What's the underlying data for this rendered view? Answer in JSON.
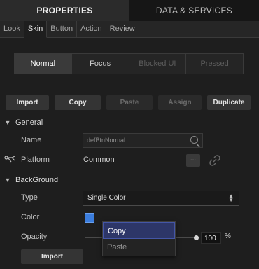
{
  "main_tabs": [
    {
      "label": "PROPERTIES",
      "active": true
    },
    {
      "label": "DATA & SERVICES",
      "active": false
    }
  ],
  "sub_tabs": [
    {
      "label": "Look"
    },
    {
      "label": "Skin"
    },
    {
      "label": "Button"
    },
    {
      "label": "Action"
    },
    {
      "label": "Review"
    }
  ],
  "states": [
    {
      "label": "Normal"
    },
    {
      "label": "Focus"
    },
    {
      "label": "Blocked UI"
    },
    {
      "label": "Pressed"
    }
  ],
  "actions": {
    "import": "Import",
    "copy": "Copy",
    "paste": "Paste",
    "assign": "Assign",
    "duplicate": "Duplicate"
  },
  "general": {
    "title": "General",
    "name_label": "Name",
    "name_value": "defBtnNormal",
    "platform_label": "Platform",
    "platform_value": "Common",
    "dots": "..."
  },
  "background": {
    "title": "BackGround",
    "type_label": "Type",
    "type_value": "Single Color",
    "color_label": "Color",
    "color_value": "#3b7ddd",
    "opacity_label": "Opacity",
    "opacity_value": "100",
    "opacity_unit": "%",
    "import_label": "Import"
  },
  "context_menu": {
    "items": [
      {
        "label": "Copy",
        "active": true
      },
      {
        "label": "Paste",
        "active": false
      }
    ]
  }
}
